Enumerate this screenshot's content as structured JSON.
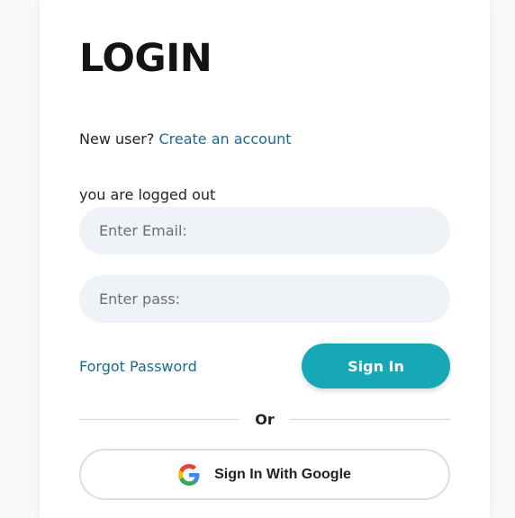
{
  "login": {
    "title": "LOGIN",
    "new_user_prompt": "New user?",
    "create_account_link": "Create an account",
    "status_text": "you are logged out",
    "email_placeholder": "Enter Email:",
    "password_placeholder": "Enter pass:",
    "forgot_password_link": "Forgot Password",
    "sign_in_button": "Sign In",
    "divider_text": "Or",
    "google_button": "Sign In With Google"
  },
  "colors": {
    "accent": "#16a8b5",
    "link": "#1b6a8f",
    "input_background": "#eff3f8"
  },
  "icons": {
    "google": "google-icon"
  }
}
